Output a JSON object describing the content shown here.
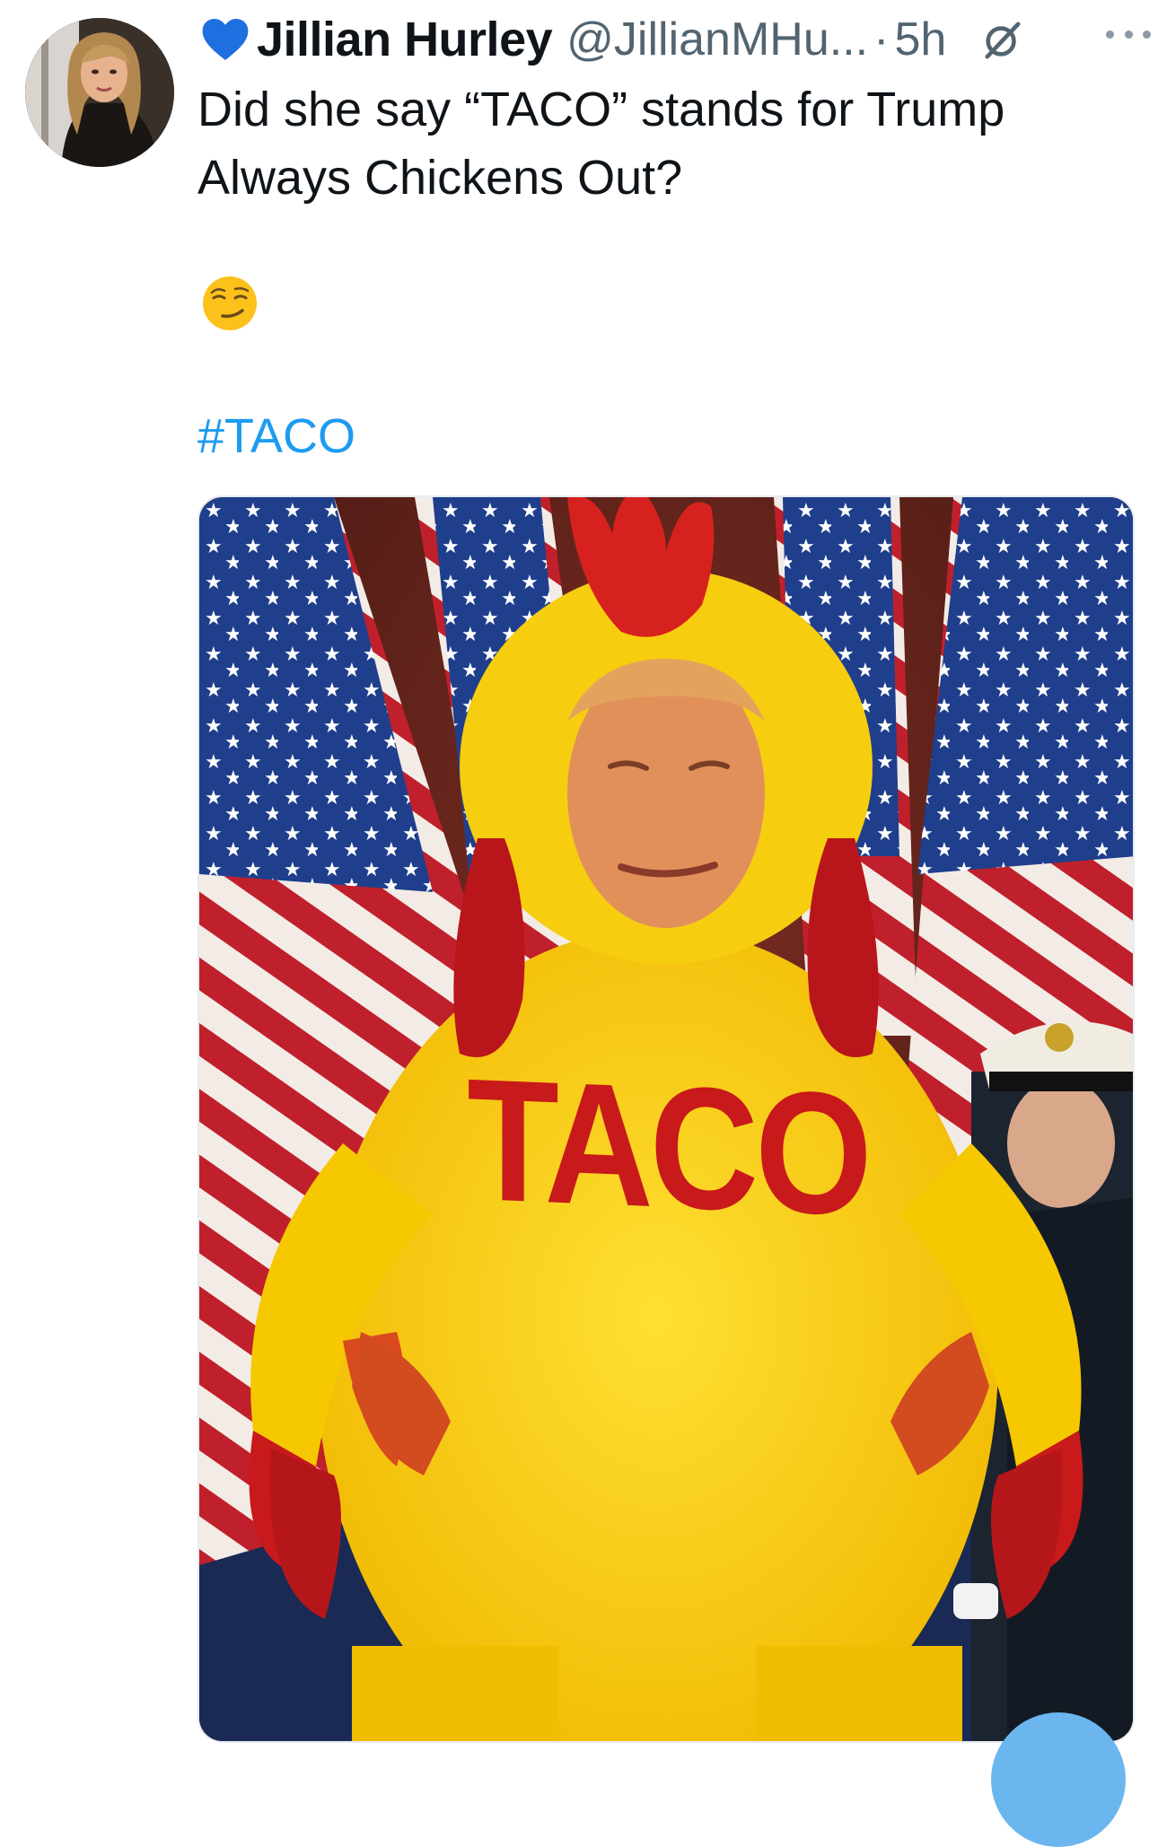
{
  "tweet": {
    "author": {
      "display_name": "Jillian Hurley",
      "handle": "@JillianMHu...",
      "badge_icon": "blue-heart-icon"
    },
    "separator": "·",
    "timestamp": "5h",
    "text_lines": [
      "Did she say “TACO” stands for Trump",
      "Always Chickens Out?"
    ],
    "emoji": "smirking-face-emoji",
    "hashtag": "#TACO",
    "media": {
      "shirt_text": "TACO"
    }
  },
  "colors": {
    "accent": "#1d9bf0",
    "secondary_text": "#536471",
    "costume_yellow": "#f5c800",
    "costume_red": "#c8191b"
  }
}
